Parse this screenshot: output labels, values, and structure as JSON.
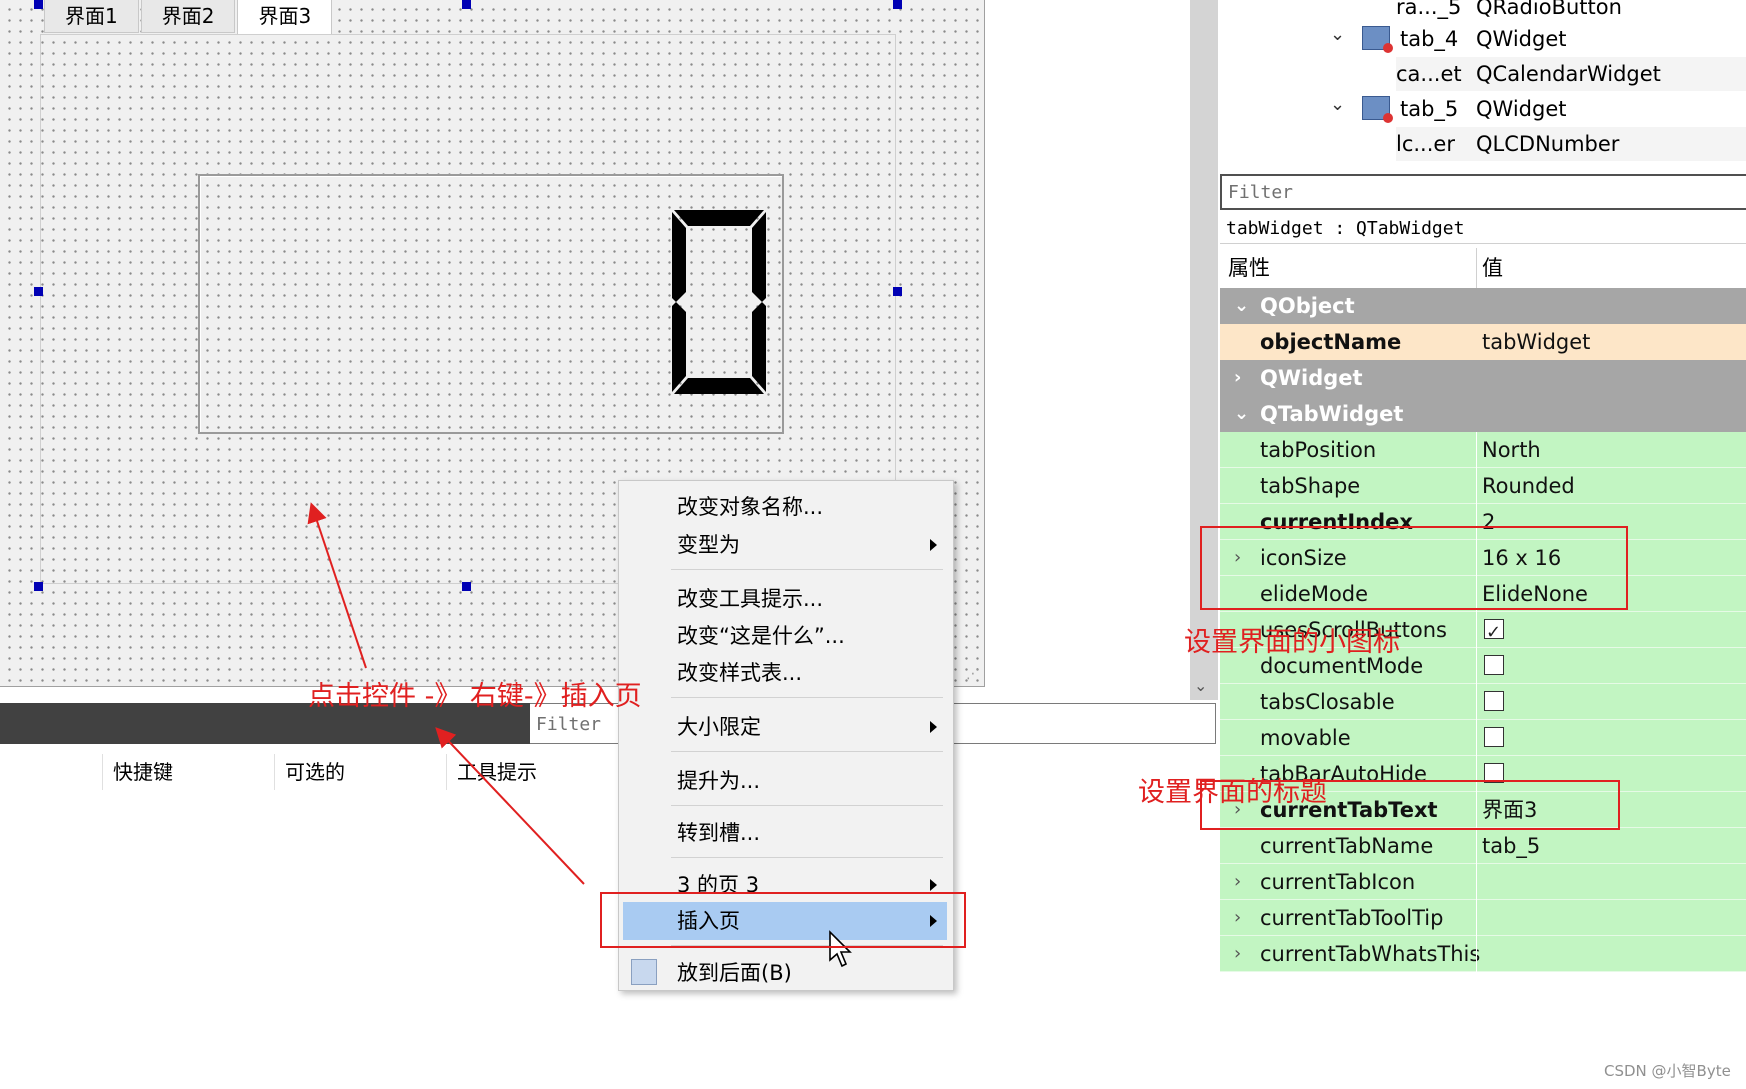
{
  "designer": {
    "tabs": [
      "界面1",
      "界面2",
      "界面3"
    ],
    "lcd_value": "0"
  },
  "bottom_panel": {
    "filter_placeholder": "Filter",
    "columns": [
      "快捷键",
      "可选的",
      "工具提示"
    ]
  },
  "context_menu": {
    "items": [
      {
        "label": "改变对象名称...",
        "submenu": false
      },
      {
        "label": "变型为",
        "submenu": true
      },
      {
        "label": "改变工具提示...",
        "submenu": false
      },
      {
        "label": "改变“这是什么”...",
        "submenu": false
      },
      {
        "label": "改变样式表...",
        "submenu": false
      },
      {
        "label": "大小限定",
        "submenu": true
      },
      {
        "label": "提升为...",
        "submenu": false
      },
      {
        "label": "转到槽...",
        "submenu": false
      },
      {
        "label": "3 的页 3",
        "submenu": true
      },
      {
        "label": "插入页",
        "submenu": true,
        "highlighted": true
      },
      {
        "label": "放到后面(B)",
        "submenu": false
      }
    ]
  },
  "object_inspector": {
    "rows": [
      {
        "name": "ra..._5",
        "class": "QRadioButton"
      },
      {
        "name": "tab_4",
        "class": "QWidget"
      },
      {
        "name": "ca...et",
        "class": "QCalendarWidget"
      },
      {
        "name": "tab_5",
        "class": "QWidget"
      },
      {
        "name": "lc...er",
        "class": "QLCDNumber"
      }
    ]
  },
  "property_editor": {
    "filter_placeholder": "Filter",
    "class_line": "tabWidget : QTabWidget",
    "header_property": "属性",
    "header_value": "值",
    "groups": {
      "qobject": "QObject",
      "qwidget": "QWidget",
      "qtabwidget": "QTabWidget"
    },
    "object_name": {
      "key": "objectName",
      "value": "tabWidget"
    },
    "props": {
      "tabPosition": {
        "key": "tabPosition",
        "value": "North"
      },
      "tabShape": {
        "key": "tabShape",
        "value": "Rounded"
      },
      "currentIndex": {
        "key": "currentIndex",
        "value": "2"
      },
      "iconSize": {
        "key": "iconSize",
        "value": "16 x 16"
      },
      "elideMode": {
        "key": "elideMode",
        "value": "ElideNone"
      },
      "usesScrollButtons": {
        "key": "usesScrollButtons",
        "checked": true
      },
      "documentMode": {
        "key": "documentMode",
        "checked": false
      },
      "tabsClosable": {
        "key": "tabsClosable",
        "checked": false
      },
      "movable": {
        "key": "movable",
        "checked": false
      },
      "tabBarAutoHide": {
        "key": "tabBarAutoHide",
        "checked": false
      },
      "currentTabText": {
        "key": "currentTabText",
        "value": "界面3"
      },
      "currentTabName": {
        "key": "currentTabName",
        "value": "tab_5"
      },
      "currentTabIcon": {
        "key": "currentTabIcon"
      },
      "currentTabToolTip": {
        "key": "currentTabToolTip"
      },
      "currentTabWhatsThis": {
        "key": "currentTabWhatsThis"
      }
    }
  },
  "annotations": {
    "click_hint": "点击控件 -》 右键-》插入页",
    "icon_hint": "设置界面的小图标",
    "title_hint": "设置界面的标题",
    "watermark": "CSDN @小智Byte"
  },
  "colors": {
    "annotation_red": "#e02020",
    "property_green": "#c2f5c2",
    "menu_highlight": "#a9cbf2",
    "group_gray": "#a6a6a6"
  }
}
